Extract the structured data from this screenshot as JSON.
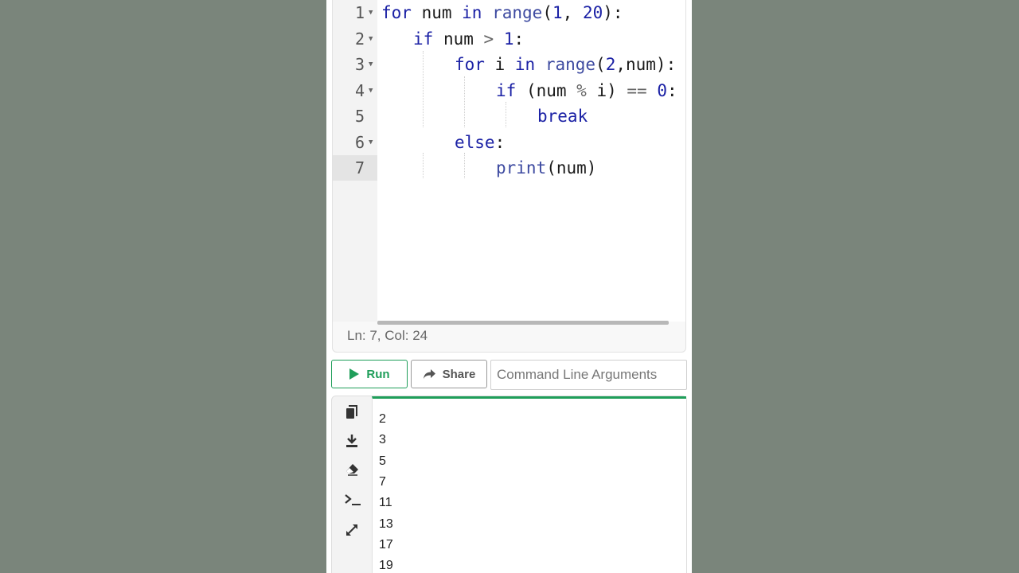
{
  "editor": {
    "line_numbers": [
      "1",
      "2",
      "3",
      "4",
      "5",
      "6",
      "7"
    ],
    "lines": [
      [
        {
          "t": "for",
          "c": "kw"
        },
        {
          "t": " num ",
          "c": ""
        },
        {
          "t": "in",
          "c": "kw"
        },
        {
          "t": " ",
          "c": ""
        },
        {
          "t": "range",
          "c": "bi"
        },
        {
          "t": "(",
          "c": ""
        },
        {
          "t": "1",
          "c": "nm"
        },
        {
          "t": ", ",
          "c": ""
        },
        {
          "t": "20",
          "c": "nm"
        },
        {
          "t": "):",
          "c": ""
        }
      ],
      [
        {
          "t": "if",
          "c": "kw"
        },
        {
          "t": " num ",
          "c": ""
        },
        {
          "t": ">",
          "c": "op"
        },
        {
          "t": " ",
          "c": ""
        },
        {
          "t": "1",
          "c": "nm"
        },
        {
          "t": ":",
          "c": ""
        }
      ],
      [
        {
          "t": "for",
          "c": "kw"
        },
        {
          "t": " i ",
          "c": ""
        },
        {
          "t": "in",
          "c": "kw"
        },
        {
          "t": " ",
          "c": ""
        },
        {
          "t": "range",
          "c": "bi"
        },
        {
          "t": "(",
          "c": ""
        },
        {
          "t": "2",
          "c": "nm"
        },
        {
          "t": ",num):",
          "c": ""
        }
      ],
      [
        {
          "t": "if",
          "c": "kw"
        },
        {
          "t": " (num ",
          "c": ""
        },
        {
          "t": "%",
          "c": "op"
        },
        {
          "t": " i) ",
          "c": ""
        },
        {
          "t": "==",
          "c": "op"
        },
        {
          "t": " ",
          "c": ""
        },
        {
          "t": "0",
          "c": "nm"
        },
        {
          "t": ":",
          "c": ""
        }
      ],
      [
        {
          "t": "break",
          "c": "kw"
        }
      ],
      [
        {
          "t": "else",
          "c": "kw"
        },
        {
          "t": ":",
          "c": ""
        }
      ],
      [
        {
          "t": "print",
          "c": "bi"
        },
        {
          "t": "(num)",
          "c": ""
        }
      ]
    ],
    "status": "Ln: 7,  Col: 24"
  },
  "toolbar": {
    "run_label": "Run",
    "share_label": "Share",
    "args_placeholder": "Command Line Arguments"
  },
  "output": {
    "lines": [
      "2",
      "3",
      "5",
      "7",
      "11",
      "13",
      "17",
      "19"
    ]
  },
  "icons": [
    "copy-icon",
    "download-icon",
    "eraser-icon",
    "terminal-icon",
    "expand-icon",
    "play-icon",
    "share-arrow-icon",
    "fold-arrow-icon"
  ],
  "colors": {
    "accent": "#1f9e5a",
    "keyword": "#1b21a5",
    "background": "#7a857b"
  }
}
